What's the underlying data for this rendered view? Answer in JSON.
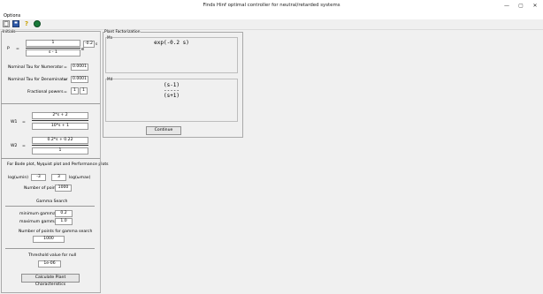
{
  "window": {
    "title": "Finds Hinf optimal controller for neutral/retarded systems",
    "minimize": "—",
    "maximize": "▢",
    "close": "✕"
  },
  "menu": {
    "options": "Options"
  },
  "toolbar": {
    "icons": [
      "new-file-icon",
      "save-icon",
      "help-icon",
      "info-icon"
    ]
  },
  "initials": {
    "heading": "Initials",
    "p_label": "P",
    "p_eq": "=",
    "p_num": "1",
    "p_den": "s - 1",
    "p_delay": "-0.2",
    "p_s": "s",
    "tau_num_label": "Nominal Tau for Numerator",
    "tau_num_eq": "=",
    "tau_num_val": "0.0001",
    "tau_den_label": "Nominal Tau for Denominator",
    "tau_den_eq": "=",
    "tau_den_val": "0.0001",
    "frac_label": "Fractional powers",
    "frac_eq": "=",
    "frac_a": "1",
    "frac_b": "1"
  },
  "weights": {
    "w1_label": "W1",
    "w1_eq": "=",
    "w1_num": "2*s + 2",
    "w1_den": "10*s + 1",
    "w2_label": "W2",
    "w2_eq": "=",
    "w2_num": "0.2*s + 0.22",
    "w2_den": "1"
  },
  "plots": {
    "heading": "For Bode plot, Nyquist plot and Performance plots",
    "log_min_label": "log(ωmin)",
    "log_min_val": "-3",
    "log_max_val": "3",
    "log_max_label": "log(ωmax)",
    "npoints_label": "Number of points",
    "npoints_val": "1000"
  },
  "gamma": {
    "heading": "Gamma Search",
    "min_label": "minimum gamma =",
    "min_val": "0.2",
    "max_label": "maximum gamma =",
    "max_val": "1.0",
    "npoints_label": "Number of points for gamma search",
    "npoints_val": "1000"
  },
  "threshold": {
    "label": "Threshold value for null",
    "val": "1e-06"
  },
  "calc_button": "Calculate Plant Characteristics",
  "factorization": {
    "title": "Plant Factorization",
    "mn_label": "Mn",
    "mn_expr": "exp(-0.2 s)",
    "md_label": "Md",
    "md_num": "(s-1)",
    "md_bar": "-----",
    "md_den": "(s+1)",
    "continue": "Continue"
  }
}
